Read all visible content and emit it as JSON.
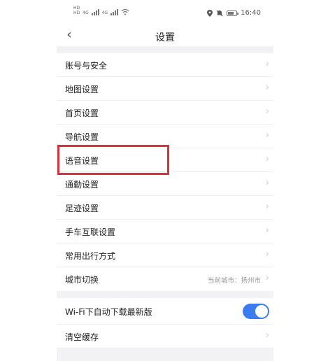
{
  "status_bar": {
    "sim_labels": [
      "HD",
      "HD"
    ],
    "network_labels": [
      "4G",
      "4G"
    ],
    "time": "16:40",
    "icons": [
      "location-icon",
      "mute-icon",
      "battery-icon"
    ]
  },
  "header": {
    "back_icon": "‹",
    "title": "设置"
  },
  "settings": {
    "items": [
      {
        "label": "账号与安全"
      },
      {
        "label": "地图设置"
      },
      {
        "label": "首页设置"
      },
      {
        "label": "导航设置"
      },
      {
        "label": "语音设置"
      },
      {
        "label": "通勤设置"
      },
      {
        "label": "足迹设置"
      },
      {
        "label": "手车互联设置"
      },
      {
        "label": "常用出行方式"
      },
      {
        "label": "城市切换",
        "value": "当前城市：扬州市"
      }
    ],
    "wifi_download": {
      "label": "Wi-Fi下自动下载最新版",
      "enabled": true
    },
    "clear_cache": {
      "label": "清空缓存"
    }
  },
  "colors": {
    "accent": "#3b7cf0",
    "highlight": "#d9313b",
    "section_gap": "#f2f2f4"
  },
  "chevron": "›"
}
